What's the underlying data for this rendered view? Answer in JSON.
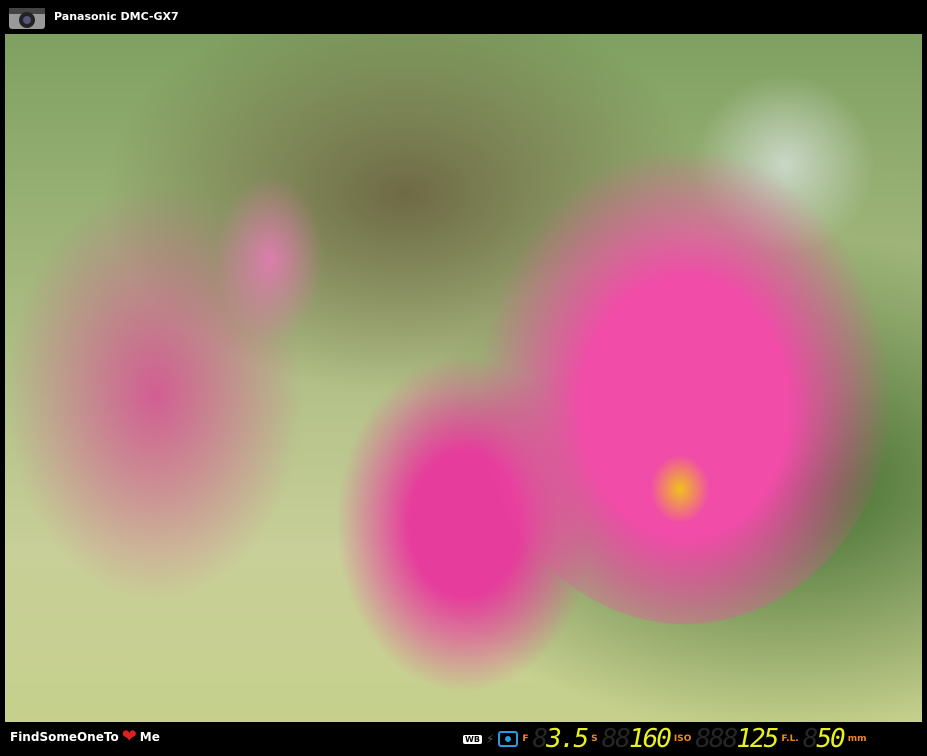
{
  "header": {
    "camera_icon": "camera-icon",
    "title": "Panasonic DMC-GX7"
  },
  "footer": {
    "brand_before": "FindSomeOneTo",
    "brand_after": "Me",
    "heart_icon": "heart-icon",
    "exif": {
      "wb_label": "WB",
      "aperture_label": "F",
      "aperture": "3.5",
      "shutter_label": "S",
      "shutter": "160",
      "iso_label": "ISO",
      "iso": "125",
      "focal_label": "F.L.",
      "focal": "50",
      "focal_unit": "mm"
    }
  },
  "colors": {
    "accent_digits": "#e8f020",
    "labels": "#f08a20",
    "metering": "#2a9be0"
  }
}
